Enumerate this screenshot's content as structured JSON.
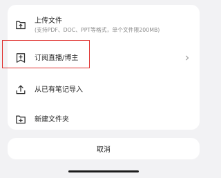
{
  "sheet": {
    "items": [
      {
        "icon": "upload-folder-icon",
        "label": "上传文件",
        "sublabel": "(支持PDF、DOC、PPT等格式，单个文件限200MB)"
      },
      {
        "icon": "bookmark-plus-icon",
        "label": "订阅直播/博主",
        "chevron": "chevron-right-icon"
      },
      {
        "icon": "upload-icon",
        "label": "从已有笔记导入"
      },
      {
        "icon": "folder-plus-icon",
        "label": "新建文件夹"
      }
    ]
  },
  "cancel": {
    "label": "取消"
  },
  "colors": {
    "highlight": "#e0302e",
    "background": "#f2f2f4",
    "card": "#ffffff"
  }
}
